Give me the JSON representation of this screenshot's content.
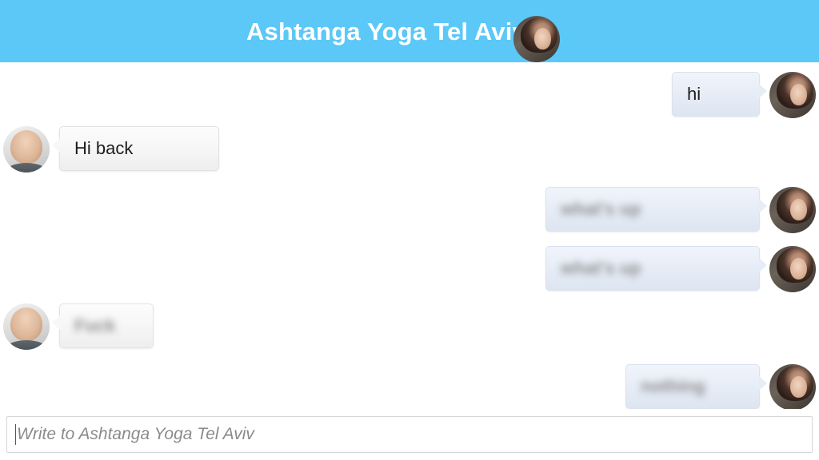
{
  "header": {
    "title": "Ashtanga Yoga Tel Aviv",
    "background_color": "#5BC8F7",
    "title_color": "#FFFFFF",
    "avatar_name": "contact-avatar-woman"
  },
  "chat": {
    "messages": [
      {
        "id": "msg-1",
        "side": "right",
        "text": "hi",
        "blurred": false,
        "avatar": "avatar-woman",
        "bubble_color": "#E7EDF7"
      },
      {
        "id": "msg-2",
        "side": "left",
        "text": "Hi back",
        "blurred": false,
        "avatar": "avatar-man",
        "bubble_color": "#F7F7F7"
      },
      {
        "id": "msg-3",
        "side": "right",
        "text": "what's up",
        "blurred": true,
        "avatar": "avatar-woman",
        "bubble_color": "#E7EDF7"
      },
      {
        "id": "msg-4",
        "side": "right",
        "text": "what's up",
        "blurred": true,
        "avatar": "avatar-woman",
        "bubble_color": "#E7EDF7"
      },
      {
        "id": "msg-5",
        "side": "left",
        "text": "Fuck",
        "blurred": true,
        "avatar": "avatar-man",
        "bubble_color": "#F7F7F7"
      },
      {
        "id": "msg-6",
        "side": "right",
        "text": "nothing",
        "blurred": true,
        "avatar": "avatar-woman",
        "bubble_color": "#E7EDF7"
      }
    ]
  },
  "composer": {
    "placeholder": "Write to Ashtanga Yoga Tel Aviv",
    "value": "",
    "placeholder_color": "#8B8B8B"
  }
}
